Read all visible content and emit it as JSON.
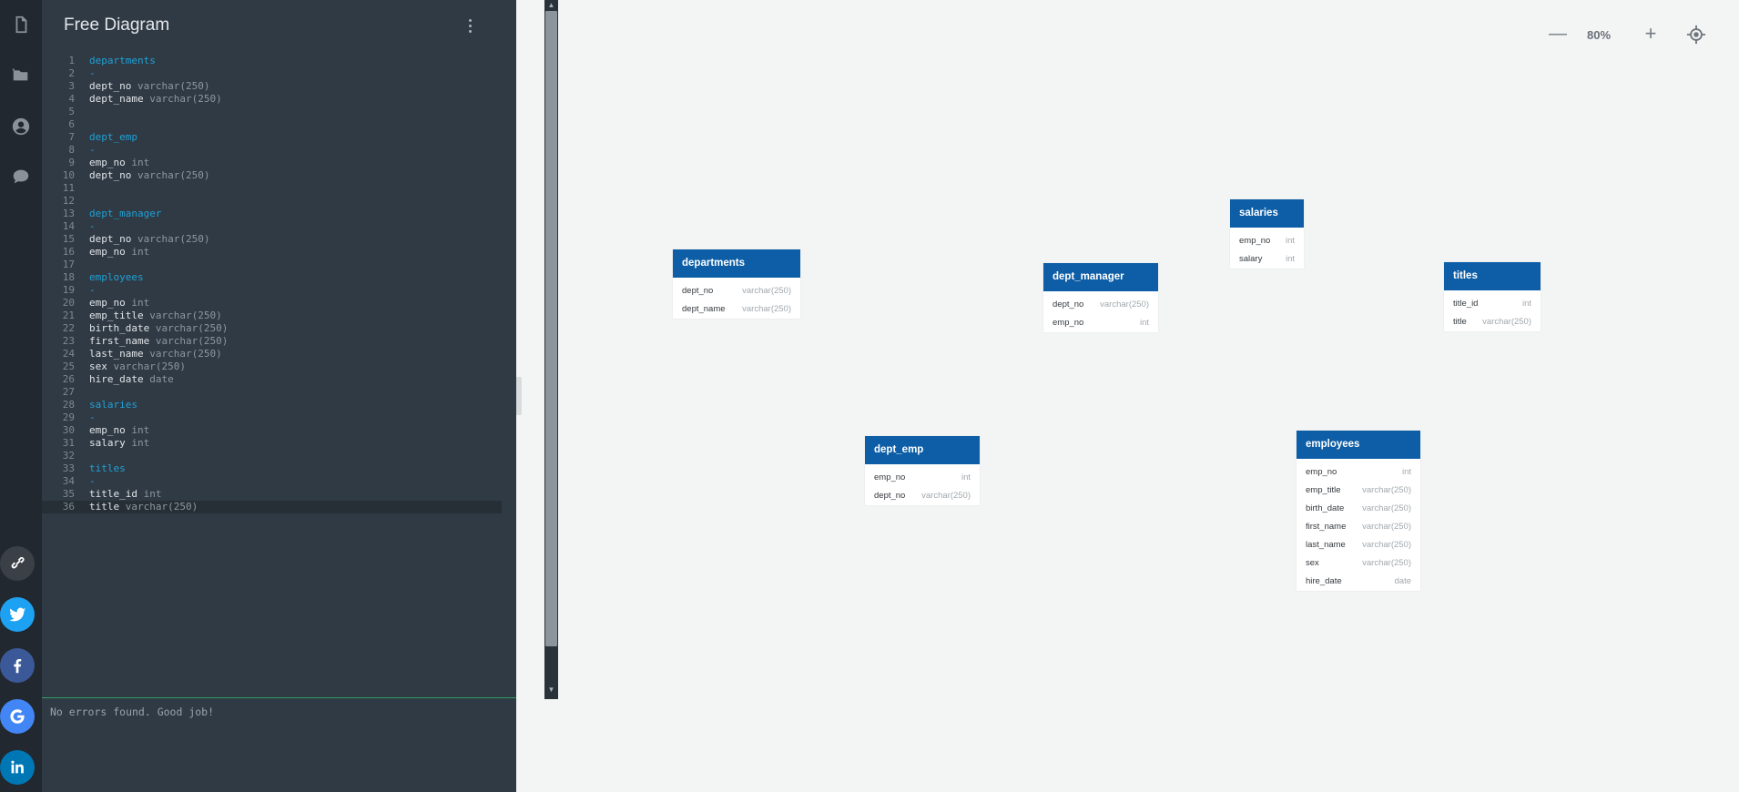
{
  "editor": {
    "title": "Free Diagram",
    "status": "No errors found. Good job!",
    "lines": [
      {
        "n": "1",
        "kind": "table",
        "name": "departments",
        "type": ""
      },
      {
        "n": "2",
        "kind": "dash",
        "name": "-",
        "type": ""
      },
      {
        "n": "3",
        "kind": "col",
        "name": "dept_no",
        "type": " varchar(250)"
      },
      {
        "n": "4",
        "kind": "col",
        "name": "dept_name",
        "type": " varchar(250)"
      },
      {
        "n": "5",
        "kind": "blank",
        "name": "",
        "type": ""
      },
      {
        "n": "6",
        "kind": "blank",
        "name": "",
        "type": ""
      },
      {
        "n": "7",
        "kind": "table",
        "name": "dept_emp",
        "type": ""
      },
      {
        "n": "8",
        "kind": "dash",
        "name": "-",
        "type": ""
      },
      {
        "n": "9",
        "kind": "col",
        "name": "emp_no",
        "type": " int"
      },
      {
        "n": "10",
        "kind": "col",
        "name": "dept_no",
        "type": " varchar(250)"
      },
      {
        "n": "11",
        "kind": "blank",
        "name": "",
        "type": ""
      },
      {
        "n": "12",
        "kind": "blank",
        "name": "",
        "type": ""
      },
      {
        "n": "13",
        "kind": "table",
        "name": "dept_manager",
        "type": ""
      },
      {
        "n": "14",
        "kind": "dash",
        "name": "-",
        "type": ""
      },
      {
        "n": "15",
        "kind": "col",
        "name": "dept_no",
        "type": " varchar(250)"
      },
      {
        "n": "16",
        "kind": "col",
        "name": "emp_no",
        "type": " int"
      },
      {
        "n": "17",
        "kind": "blank",
        "name": "",
        "type": ""
      },
      {
        "n": "18",
        "kind": "table",
        "name": "employees",
        "type": ""
      },
      {
        "n": "19",
        "kind": "dash",
        "name": "-",
        "type": ""
      },
      {
        "n": "20",
        "kind": "col",
        "name": "emp_no",
        "type": " int"
      },
      {
        "n": "21",
        "kind": "col",
        "name": "emp_title",
        "type": " varchar(250)"
      },
      {
        "n": "22",
        "kind": "col",
        "name": "birth_date",
        "type": " varchar(250)"
      },
      {
        "n": "23",
        "kind": "col",
        "name": "first_name",
        "type": " varchar(250)"
      },
      {
        "n": "24",
        "kind": "col",
        "name": "last_name",
        "type": " varchar(250)"
      },
      {
        "n": "25",
        "kind": "col",
        "name": "sex",
        "type": " varchar(250)"
      },
      {
        "n": "26",
        "kind": "col",
        "name": "hire_date",
        "type": " date"
      },
      {
        "n": "27",
        "kind": "blank",
        "name": "",
        "type": ""
      },
      {
        "n": "28",
        "kind": "table",
        "name": "salaries",
        "type": ""
      },
      {
        "n": "29",
        "kind": "dash",
        "name": "-",
        "type": ""
      },
      {
        "n": "30",
        "kind": "col",
        "name": "emp_no",
        "type": " int"
      },
      {
        "n": "31",
        "kind": "col",
        "name": "salary",
        "type": " int"
      },
      {
        "n": "32",
        "kind": "blank",
        "name": "",
        "type": ""
      },
      {
        "n": "33",
        "kind": "table",
        "name": "titles",
        "type": ""
      },
      {
        "n": "34",
        "kind": "dash",
        "name": "-",
        "type": ""
      },
      {
        "n": "35",
        "kind": "col",
        "name": "title_id",
        "type": " int"
      },
      {
        "n": "36",
        "kind": "col",
        "name": "title",
        "type": " varchar(250)",
        "active": true
      }
    ]
  },
  "sidebar": {
    "icons": [
      "document-icon",
      "folder-icon",
      "user-icon",
      "chat-icon"
    ],
    "share": [
      {
        "name": "link-share-button",
        "icon": "link-icon",
        "color": "#3b4047"
      },
      {
        "name": "twitter-share-button",
        "icon": "twitter-icon",
        "color": "#1da1f2"
      },
      {
        "name": "facebook-share-button",
        "icon": "facebook-icon",
        "color": "#3b5998"
      },
      {
        "name": "google-share-button",
        "icon": "google-icon",
        "color": "#4285f4"
      },
      {
        "name": "linkedin-share-button",
        "icon": "linkedin-icon",
        "color": "#0077b5"
      }
    ]
  },
  "canvas": {
    "zoom": "80%",
    "zoom_minus": "—",
    "zoom_plus": "+",
    "tables": [
      {
        "name": "departments",
        "columns": [
          {
            "name": "dept_no",
            "type": "varchar(250)"
          },
          {
            "name": "dept_name",
            "type": "varchar(250)"
          }
        ]
      },
      {
        "name": "dept_manager",
        "columns": [
          {
            "name": "dept_no",
            "type": "varchar(250)"
          },
          {
            "name": "emp_no",
            "type": "int"
          }
        ]
      },
      {
        "name": "salaries",
        "columns": [
          {
            "name": "emp_no",
            "type": "int"
          },
          {
            "name": "salary",
            "type": "int"
          }
        ]
      },
      {
        "name": "titles",
        "columns": [
          {
            "name": "title_id",
            "type": "int"
          },
          {
            "name": "title",
            "type": "varchar(250)"
          }
        ]
      },
      {
        "name": "dept_emp",
        "columns": [
          {
            "name": "emp_no",
            "type": "int"
          },
          {
            "name": "dept_no",
            "type": "varchar(250)"
          }
        ]
      },
      {
        "name": "employees",
        "columns": [
          {
            "name": "emp_no",
            "type": "int"
          },
          {
            "name": "emp_title",
            "type": "varchar(250)"
          },
          {
            "name": "birth_date",
            "type": "varchar(250)"
          },
          {
            "name": "first_name",
            "type": "varchar(250)"
          },
          {
            "name": "last_name",
            "type": "varchar(250)"
          },
          {
            "name": "sex",
            "type": "varchar(250)"
          },
          {
            "name": "hire_date",
            "type": "date"
          }
        ]
      }
    ]
  },
  "colors": {
    "header_blue": "#0d5ea6",
    "editor_bg": "#303a44",
    "keyword_blue": "#1fa1d6",
    "ok_green": "#2f9f63"
  }
}
